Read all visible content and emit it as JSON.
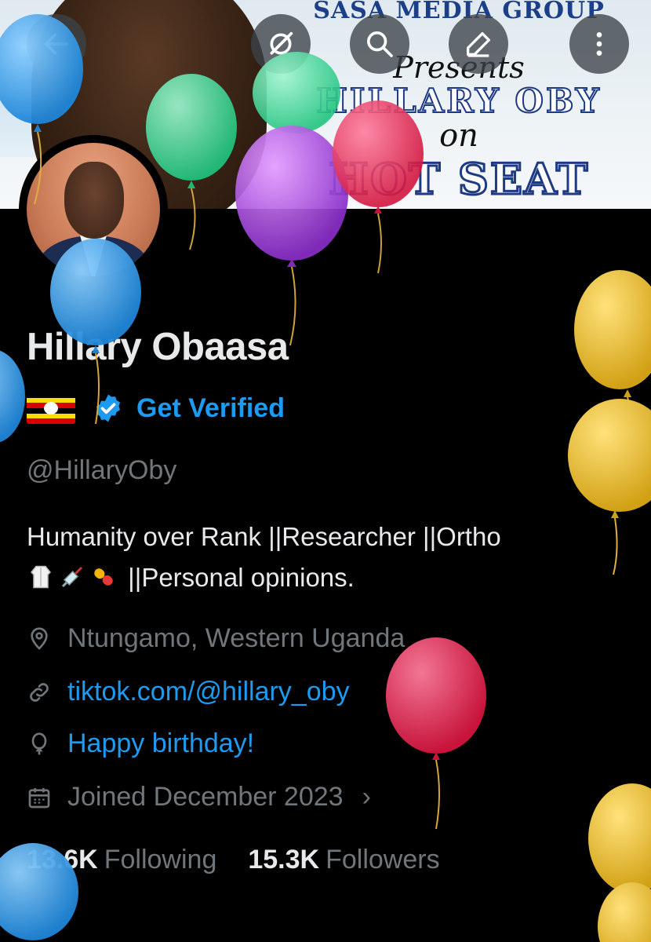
{
  "banner": {
    "line1": "SASA MEDIA GROUP",
    "line2": "Presents",
    "line3": "HILLARY OBY",
    "line4": "on",
    "line5": "HOT SEAT"
  },
  "top_bar": {
    "back_icon": "arrow-left-icon",
    "grok_icon": "grok-icon",
    "search_icon": "search-icon",
    "edit_icon": "pencil-icon",
    "more_icon": "more-vertical-icon"
  },
  "profile": {
    "name": "Hillary Obaasa",
    "get_verified": "Get Verified",
    "handle": "@HillaryOby",
    "bio_line1": "Humanity over Rank ||Researcher ||Ortho",
    "bio_line2": "||Personal opinions.",
    "bio_emojis": [
      "lab-coat-emoji",
      "syringe-emoji",
      "pill-emoji"
    ],
    "location": "Ntungamo, Western Uganda",
    "website": "tiktok.com/@hillary_oby",
    "birthday": "Happy birthday!",
    "joined": "Joined December 2023",
    "following_count": "13.6K",
    "following_label": "Following",
    "followers_count": "15.3K",
    "followers_label": "Followers"
  },
  "colors": {
    "background": "#000000",
    "text_primary": "#e7e9ea",
    "text_secondary": "#71767b",
    "accent": "#1d9bf0"
  }
}
